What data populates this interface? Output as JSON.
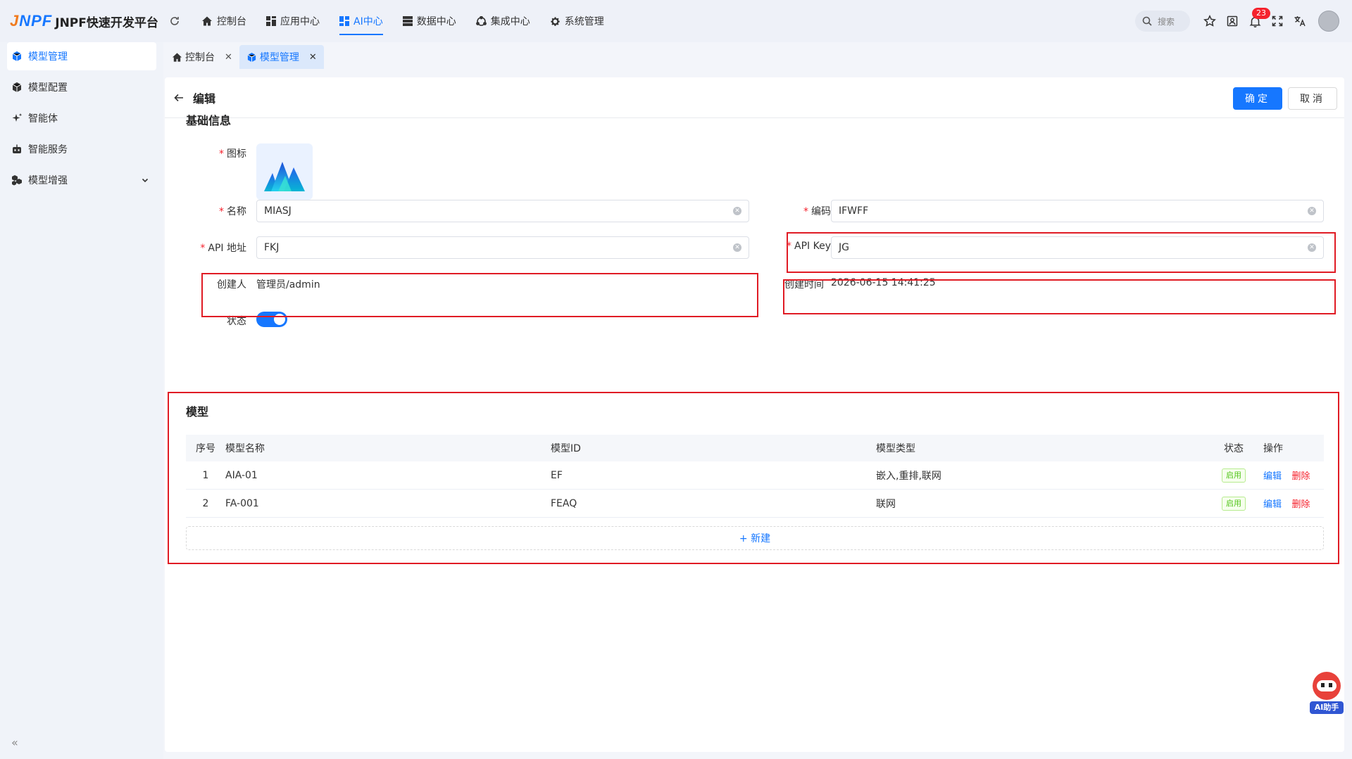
{
  "app": {
    "logo_mark": "JNPF",
    "logo_text": "JNPF快速开发平台"
  },
  "topnav": [
    {
      "label": "控制台",
      "icon": "home-icon"
    },
    {
      "label": "应用中心",
      "icon": "apps-icon"
    },
    {
      "label": "AI中心",
      "icon": "ai-center-icon",
      "active": true
    },
    {
      "label": "数据中心",
      "icon": "database-icon"
    },
    {
      "label": "集成中心",
      "icon": "integration-icon"
    },
    {
      "label": "系统管理",
      "icon": "gear-icon"
    }
  ],
  "topright": {
    "search_placeholder": "搜索",
    "notification_count": "23"
  },
  "sidebar": {
    "items": [
      {
        "label": "模型管理",
        "icon": "cube-icon",
        "active": true
      },
      {
        "label": "模型配置",
        "icon": "box-icon"
      },
      {
        "label": "智能体",
        "icon": "sparkle-icon"
      },
      {
        "label": "智能服务",
        "icon": "robot-icon"
      },
      {
        "label": "模型增强",
        "icon": "cubes-icon",
        "expandable": true
      }
    ],
    "collapse_label": "«"
  },
  "tabs": [
    {
      "label": "控制台",
      "icon": "home-icon"
    },
    {
      "label": "模型管理",
      "icon": "cube-icon",
      "active": true
    }
  ],
  "page": {
    "title": "编辑",
    "confirm_label": "确定",
    "cancel_label": "取消"
  },
  "basic": {
    "section_title": "基础信息",
    "icon_label": "图标",
    "name_label": "名称",
    "name_value": "MIASJ",
    "code_label": "编码",
    "code_value": "IFWFF",
    "api_url_label": "API 地址",
    "api_url_value": "FKJ",
    "api_key_label": "API Key",
    "api_key_value": "JG",
    "creator_label": "创建人",
    "creator_value": "管理员/admin",
    "created_time_label": "创建时间",
    "created_time_value": "2026-06-15 14:41:25",
    "status_label": "状态",
    "status_on": true
  },
  "models": {
    "section_title": "模型",
    "columns": [
      "序号",
      "模型名称",
      "模型ID",
      "模型类型",
      "状态",
      "操作"
    ],
    "rows": [
      {
        "idx": "1",
        "name": "AIA-01",
        "id": "EF",
        "type": "嵌入,重排,联网",
        "status": "启用",
        "edit": "编辑",
        "delete": "删除"
      },
      {
        "idx": "2",
        "name": "FA-001",
        "id": "FEAQ",
        "type": "联网",
        "status": "启用",
        "edit": "编辑",
        "delete": "删除"
      }
    ],
    "add_label": "+ 新建"
  },
  "ai_helper": {
    "label": "AI助手"
  }
}
